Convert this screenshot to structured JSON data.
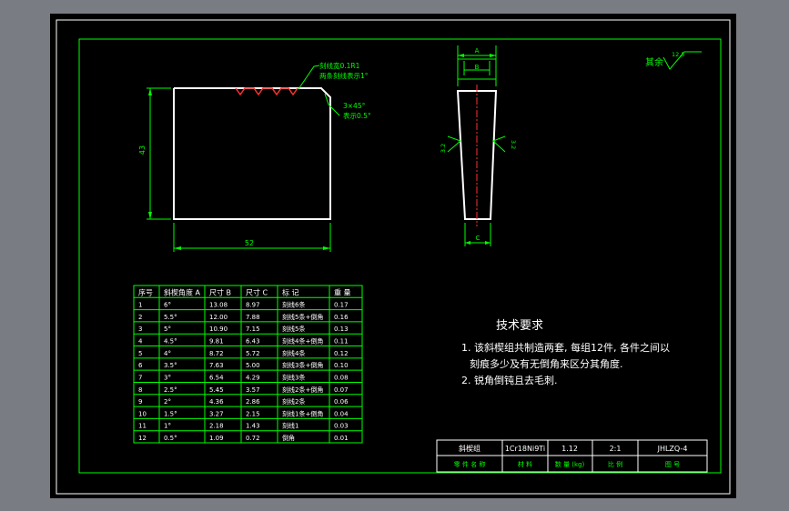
{
  "notes_top": {
    "line1": "刻线宽0.1R1",
    "line2": "两条刻线表示1°",
    "chamfer1": "3×45°",
    "chamfer2": "表示0.5°"
  },
  "dims": {
    "height": "43",
    "width": "52",
    "A": "A",
    "B": "B",
    "C": "C",
    "r1": "3.2",
    "r2": "3.2"
  },
  "roughness": {
    "label": "其余",
    "value": "12.5"
  },
  "table": {
    "headers": [
      "序号",
      "斜楔角度 A",
      "尺寸 B",
      "尺寸 C",
      "标 记",
      "重 量"
    ],
    "rows": [
      [
        "1",
        "6°",
        "13.08",
        "8.97",
        "刻线6条",
        "0.17"
      ],
      [
        "2",
        "5.5°",
        "12.00",
        "7.88",
        "刻线5条+倒角",
        "0.16"
      ],
      [
        "3",
        "5°",
        "10.90",
        "7.15",
        "刻线5条",
        "0.13"
      ],
      [
        "4",
        "4.5°",
        "9.81",
        "6.43",
        "刻线4条+倒角",
        "0.11"
      ],
      [
        "5",
        "4°",
        "8.72",
        "5.72",
        "刻线4条",
        "0.12"
      ],
      [
        "6",
        "3.5°",
        "7.63",
        "5.00",
        "刻线3条+倒角",
        "0.10"
      ],
      [
        "7",
        "3°",
        "6.54",
        "4.29",
        "刻线3条",
        "0.08"
      ],
      [
        "8",
        "2.5°",
        "5.45",
        "3.57",
        "刻线2条+倒角",
        "0.07"
      ],
      [
        "9",
        "2°",
        "4.36",
        "2.86",
        "刻线2条",
        "0.06"
      ],
      [
        "10",
        "1.5°",
        "3.27",
        "2.15",
        "刻线1条+倒角",
        "0.04"
      ],
      [
        "11",
        "1°",
        "2.18",
        "1.43",
        "刻线1",
        "0.03"
      ],
      [
        "12",
        "0.5°",
        "1.09",
        "0.72",
        "倒角",
        "0.01"
      ]
    ]
  },
  "tech": {
    "title": "技术要求",
    "item1a": "1.  该斜楔组共制造两套, 每组12件, 各件之间以",
    "item1b": "刻痕多少及有无倒角来区分其角度.",
    "item2": "2. 锐角倒钝且去毛刺."
  },
  "title_block": {
    "name": "斜楔组",
    "material": "1Cr18Ni9Ti",
    "count": "1.12",
    "scale": "2:1",
    "code": "JHLZQ-4",
    "l_part": "零 件 名 称",
    "l_mat": "材 料",
    "l_qty": "数 量 (kg)",
    "l_scale": "比 例",
    "l_code": "图 号"
  }
}
